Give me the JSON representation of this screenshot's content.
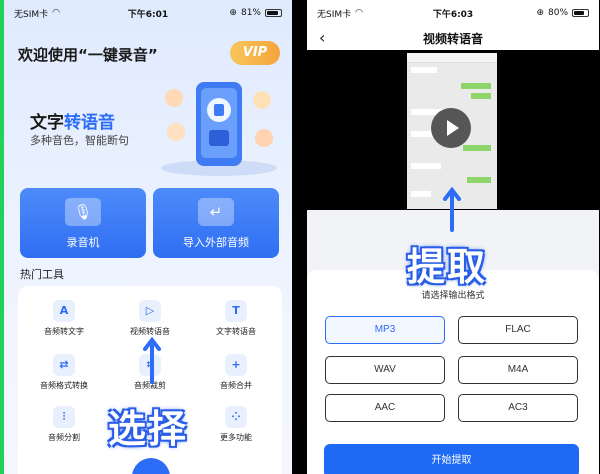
{
  "left_phone": {
    "status": {
      "carrier": "无SIM卡",
      "time": "下午6:01",
      "battery": "81%",
      "battery_level": 0.81
    },
    "welcome": "欢迎使用“一键录音”",
    "vip_label": "VIP",
    "hero": {
      "title_plain": "文字",
      "title_accent": "转语音",
      "subtitle": "多种音色，智能断句"
    },
    "cards": [
      {
        "label": "录音机",
        "icon": "microphone-icon"
      },
      {
        "label": "导入外部音频",
        "icon": "import-icon"
      }
    ],
    "section_title": "热门工具",
    "tools": [
      {
        "label": "音频转文字",
        "icon": "audio-to-text-icon"
      },
      {
        "label": "视频转语音",
        "icon": "video-to-audio-icon"
      },
      {
        "label": "文字转语音",
        "icon": "text-to-speech-icon"
      },
      {
        "label": "音频格式转换",
        "icon": "format-convert-icon"
      },
      {
        "label": "音频裁剪",
        "icon": "crop-icon"
      },
      {
        "label": "音频合并",
        "icon": "merge-icon"
      },
      {
        "label": "音频分割",
        "icon": "split-icon"
      },
      {
        "label": "",
        "icon": ""
      },
      {
        "label": "更多功能",
        "icon": "more-icon"
      }
    ],
    "overlay_text": "选择"
  },
  "right_phone": {
    "status": {
      "carrier": "无SIM卡",
      "time": "下午6:03",
      "battery": "80%",
      "battery_level": 0.8
    },
    "nav_title": "视频转语音",
    "overlay_text": "提取",
    "format_hint": "请选择输出格式",
    "formats": [
      "MP3",
      "FLAC",
      "WAV",
      "M4A",
      "AAC",
      "AC3"
    ],
    "selected_format": "MP3",
    "extract_button": "开始提取"
  },
  "colors": {
    "accent": "#2d6cf6",
    "vip": "#f4a43b",
    "highlight_border": "#22d15a"
  }
}
